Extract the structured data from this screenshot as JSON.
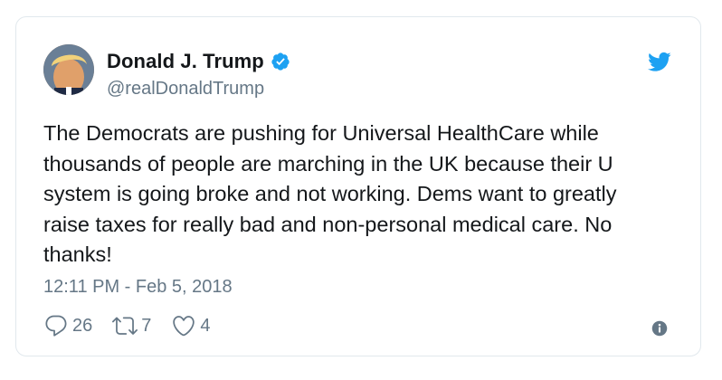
{
  "tweet": {
    "display_name": "Donald J. Trump",
    "handle": "@realDonaldTrump",
    "text": "The Democrats are pushing for Universal HealthCare while thousands of people are marching in the UK because their U system is going broke and not working. Dems want to greatly raise taxes for really bad and non-personal medical care. No thanks!",
    "timestamp": "12:11 PM - Feb 5, 2018",
    "reply_count": "26",
    "retweet_count": "7",
    "like_count": "4"
  },
  "icons": {
    "verified": "verified-badge-icon",
    "platform": "twitter-bird-icon",
    "reply": "reply-icon",
    "retweet": "retweet-icon",
    "like": "heart-icon",
    "info": "info-icon"
  },
  "colors": {
    "brand_blue": "#1da1f2",
    "secondary_text": "#657786",
    "primary_text": "#14171a",
    "border": "#e1e8ed"
  }
}
